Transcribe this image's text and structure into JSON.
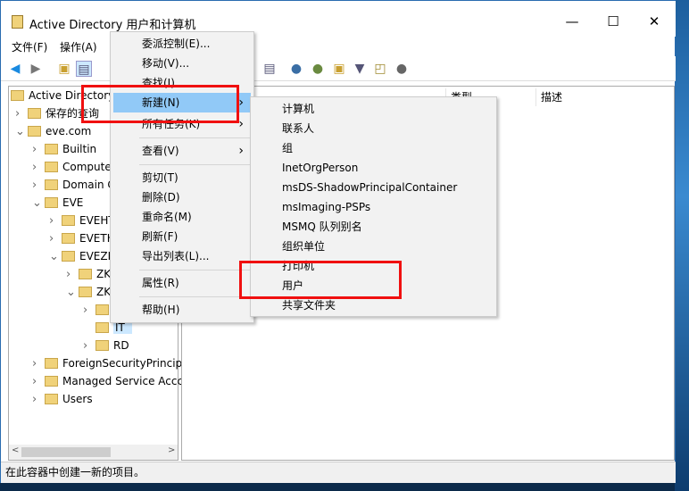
{
  "window": {
    "title": "Active Directory 用户和计算机",
    "minimize": "—",
    "maximize": "☐",
    "close": "✕"
  },
  "menubar": [
    "文件(F)",
    "操作(A)"
  ],
  "toolbar_icons": [
    "back-arrow-icon",
    "forward-arrow-icon",
    "up-folder-icon",
    "show-tree-icon",
    "show-action-pane-icon",
    "new-user-icon",
    "new-group-icon",
    "new-ou-icon",
    "filter-icon",
    "find-icon",
    "delegate-icon"
  ],
  "tree": [
    {
      "label": "Active Directory",
      "depth": 0,
      "exp": ""
    },
    {
      "label": "保存的查询",
      "depth": 1,
      "exp": ">"
    },
    {
      "label": "eve.com",
      "depth": 1,
      "exp": "v"
    },
    {
      "label": "Builtin",
      "depth": 2,
      "exp": ">"
    },
    {
      "label": "Computer",
      "depth": 2,
      "exp": ">"
    },
    {
      "label": "Domain C",
      "depth": 2,
      "exp": ">"
    },
    {
      "label": "EVE",
      "depth": 2,
      "exp": "v"
    },
    {
      "label": "EVEHT",
      "depth": 3,
      "exp": ">"
    },
    {
      "label": "EVETH",
      "depth": 3,
      "exp": ">"
    },
    {
      "label": "EVEZK",
      "depth": 3,
      "exp": "v"
    },
    {
      "label": "ZK-",
      "depth": 4,
      "exp": ">"
    },
    {
      "label": "ZK-",
      "depth": 4,
      "exp": "v"
    },
    {
      "label": "",
      "depth": 5,
      "exp": ">"
    },
    {
      "label": "IT",
      "depth": 5,
      "exp": "",
      "selected": true
    },
    {
      "label": "RD",
      "depth": 5,
      "exp": ">"
    },
    {
      "label": "ForeignSecurityPrincipa",
      "depth": 2,
      "exp": ">"
    },
    {
      "label": "Managed Service Accc",
      "depth": 2,
      "exp": ">"
    },
    {
      "label": "Users",
      "depth": 2,
      "exp": ">"
    }
  ],
  "columns": [
    "类型",
    "描述"
  ],
  "context_menu": [
    {
      "label": "委派控制(E)..."
    },
    {
      "label": "移动(V)..."
    },
    {
      "label": "查找(I)..."
    },
    {
      "label": "新建(N)",
      "submenu": true,
      "highlighted": true
    },
    {
      "label": "所有任务(K)",
      "submenu": true
    },
    {
      "sep": true
    },
    {
      "label": "查看(V)",
      "submenu": true
    },
    {
      "sep": true
    },
    {
      "label": "剪切(T)"
    },
    {
      "label": "删除(D)"
    },
    {
      "label": "重命名(M)"
    },
    {
      "label": "刷新(F)"
    },
    {
      "label": "导出列表(L)..."
    },
    {
      "sep": true
    },
    {
      "label": "属性(R)"
    },
    {
      "sep": true
    },
    {
      "label": "帮助(H)"
    }
  ],
  "submenu": [
    "计算机",
    "联系人",
    "组",
    "InetOrgPerson",
    "msDS-ShadowPrincipalContainer",
    "msImaging-PSPs",
    "MSMQ 队列别名",
    "组织单位",
    "打印机",
    "用户",
    "共享文件夹"
  ],
  "status": "在此容器中创建一新的项目。",
  "colors": {
    "highlight": "#91c9f7",
    "annotation": "#f01010",
    "selection": "#cce8ff"
  }
}
